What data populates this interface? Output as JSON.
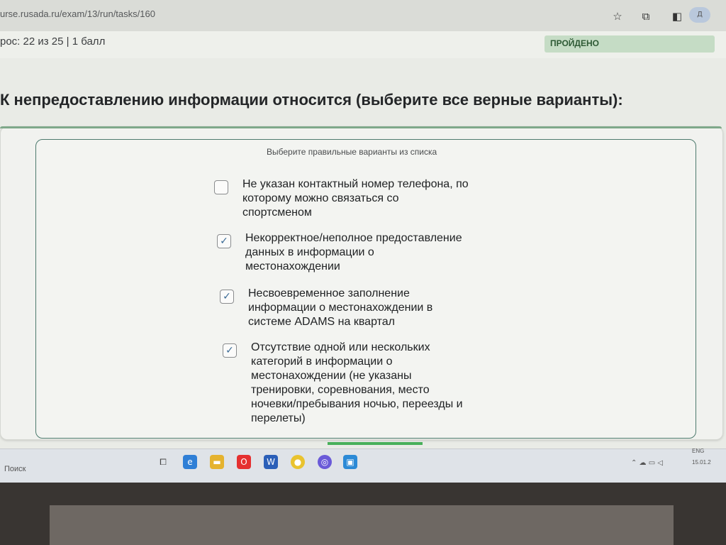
{
  "browser": {
    "url": "urse.rusada.ru/exam/13/run/tasks/160",
    "star_icon": "star-icon",
    "extensions_icon": "puzzle-icon",
    "profile_label": "Д"
  },
  "quiz": {
    "progress": "рос: 22 из 25 | 1 балл",
    "status": "ПРОЙДЕНО",
    "question": "К непредоставлению информации относится (выберите все верные варианты):",
    "hint": "Выберите правильные варианты из списка",
    "options": [
      {
        "label": "Не указан контактный номер телефона, по\nкоторому можно связаться со\nспортсменом",
        "checked": false
      },
      {
        "label": "Некорректное/неполное предоставление\nданных в информации о\nместонахождении",
        "checked": true
      },
      {
        "label": "Несвоевременное заполнение\nинформации о местонахождении в\nсистеме ADAMS на квартал",
        "checked": true
      },
      {
        "label": "Отсутствие одной или нескольких\nкатегорий в информации о\nместонахождении (не указаны\nтренировки, соревнования, место\nночевки/пребывания ночью, переезды и\nперелеты)",
        "checked": true
      }
    ]
  },
  "taskbar": {
    "search": "Поиск",
    "lang": "ENG",
    "date": "15.01.2"
  },
  "colors": {
    "status_bg": "#c5dcc5",
    "check": "#3a6a95",
    "progress": "#48b05a"
  }
}
